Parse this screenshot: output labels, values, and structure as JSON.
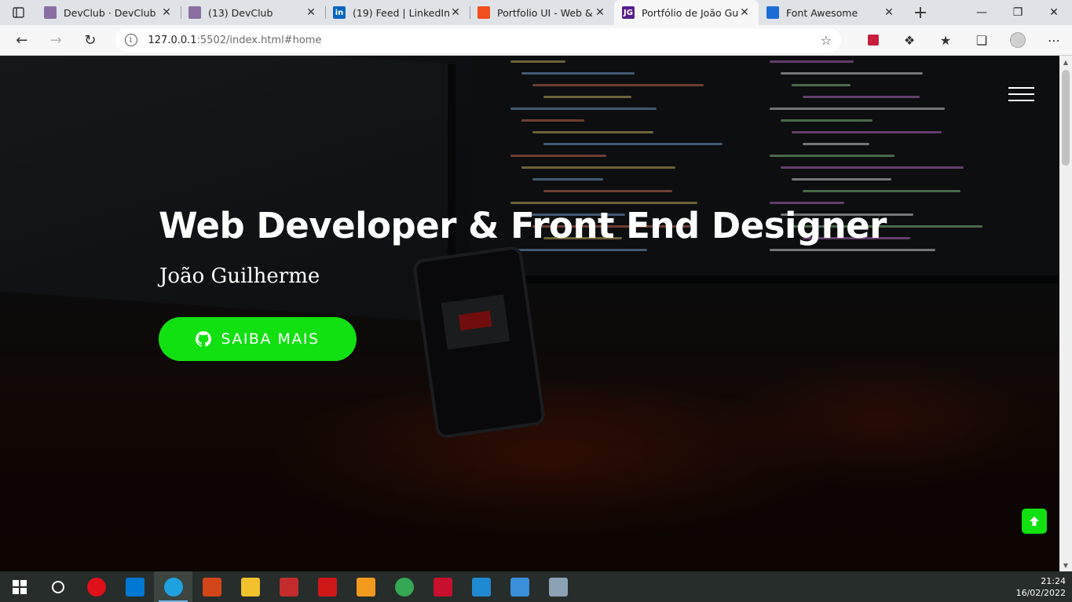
{
  "browser": {
    "tabs": [
      {
        "title": "DevClub · DevClub",
        "favicon": "devclub-favicon",
        "color": "#8a6fa3",
        "active": false
      },
      {
        "title": "(13) DevClub",
        "favicon": "devclub-favicon",
        "color": "#8a6fa3",
        "active": false
      },
      {
        "title": "(19) Feed | LinkedIn",
        "favicon": "linkedin-favicon",
        "color": "#0a66c2",
        "glyph": "in",
        "active": false
      },
      {
        "title": "Portfolio UI - Web & M",
        "favicon": "figma-favicon",
        "color": "#f24e1e",
        "active": false
      },
      {
        "title": "Portfólio de João Guilh",
        "favicon": "jg-favicon",
        "color": "#5b1f8f",
        "glyph": "JG",
        "active": true
      },
      {
        "title": "Font Awesome",
        "favicon": "flag-favicon",
        "color": "#1c6ed6",
        "active": false
      }
    ],
    "url_host": "127.0.0.1",
    "url_path": ":5502/index.html#home"
  },
  "hero": {
    "title": "Web Developer & Front End Designer",
    "subtitle": "João Guilherme",
    "cta_label": "SAIBA MAIS"
  },
  "colors": {
    "accent": "#11e011"
  },
  "taskbar": {
    "apps": [
      {
        "name": "windows-start",
        "color": "#ffffff"
      },
      {
        "name": "cortana-search",
        "color": "#ffffff"
      },
      {
        "name": "opera",
        "color": "#e0101b"
      },
      {
        "name": "microsoft-store",
        "color": "#0078d4"
      },
      {
        "name": "edge",
        "color": "#1fa1e0",
        "active": true
      },
      {
        "name": "office-app",
        "color": "#d2461a"
      },
      {
        "name": "file-explorer",
        "color": "#f2c12e"
      },
      {
        "name": "g-app",
        "color": "#c32c2c"
      },
      {
        "name": "t-app",
        "color": "#d01717"
      },
      {
        "name": "sublime-text",
        "color": "#f29a1e"
      },
      {
        "name": "chrome",
        "color": "#34a853"
      },
      {
        "name": "mcafee",
        "color": "#c8102e"
      },
      {
        "name": "vscode",
        "color": "#1f8ad2"
      },
      {
        "name": "photos",
        "color": "#3a8fd8"
      },
      {
        "name": "control-panel",
        "color": "#8aa2b4"
      }
    ],
    "time": "21:24",
    "date": "16/02/2022"
  }
}
